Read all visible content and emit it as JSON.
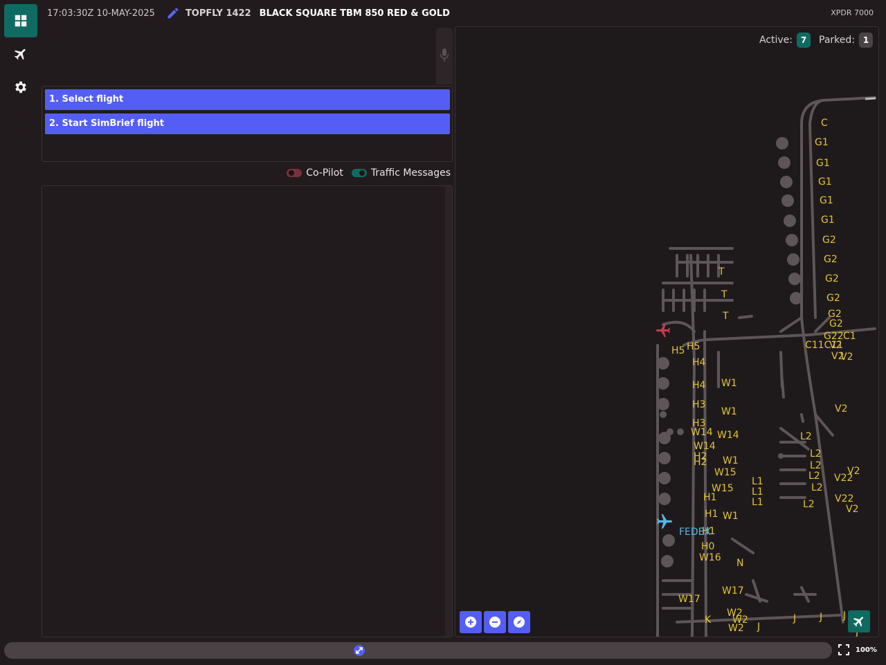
{
  "header": {
    "time": "17:03:30Z 10-MAY-2025",
    "callsign": "TOPFLY 1422",
    "aircraft": "BLACK SQUARE TBM 850 RED & GOLD",
    "xpdr": "XPDR 7000"
  },
  "nav": {
    "items": [
      {
        "name": "dashboard-icon",
        "active": true
      },
      {
        "name": "plane-icon",
        "active": false
      },
      {
        "name": "gear-icon",
        "active": false
      }
    ]
  },
  "actions": {
    "select_flight": "1. Select flight",
    "start_simbrief": "2. Start SimBrief flight"
  },
  "toggles": {
    "copilot_label": "Co-Pilot",
    "copilot_on": false,
    "traffic_label": "Traffic Messages",
    "traffic_on": true
  },
  "map": {
    "active_label": "Active:",
    "active_count": "7",
    "parked_label": "Parked:",
    "parked_count": "1",
    "traffic_callsign": "FEDEX",
    "labels": [
      "C",
      "G1",
      "G1",
      "G1",
      "G1",
      "G1",
      "G2",
      "G2",
      "G2",
      "G2",
      "G2",
      "G2",
      "G22",
      "C1",
      "C11C11",
      "V2",
      "V2",
      "V2",
      "V2",
      "V2",
      "V2",
      "V22",
      "V22",
      "L2",
      "L2",
      "L2",
      "L2",
      "L2",
      "L2",
      "L1",
      "L1",
      "L1",
      "T",
      "T",
      "T",
      "H5",
      "H5",
      "H4",
      "H4",
      "H3",
      "H3",
      "H2",
      "H2",
      "H1",
      "H1",
      "H1",
      "H0",
      "W1",
      "W1",
      "W1",
      "W1",
      "W14",
      "W14",
      "W14",
      "W15",
      "W15",
      "W16",
      "W17",
      "W17",
      "W2",
      "W2",
      "W2",
      "N",
      "K",
      "J",
      "J",
      "J",
      "J",
      "J"
    ],
    "zoom_percent": "100%"
  },
  "colors": {
    "accent": "#545ef5",
    "teal": "#0f6b61",
    "label_yellow": "#e3c534",
    "traffic_cyan": "#56b7e6",
    "user_red": "#c8384e"
  }
}
